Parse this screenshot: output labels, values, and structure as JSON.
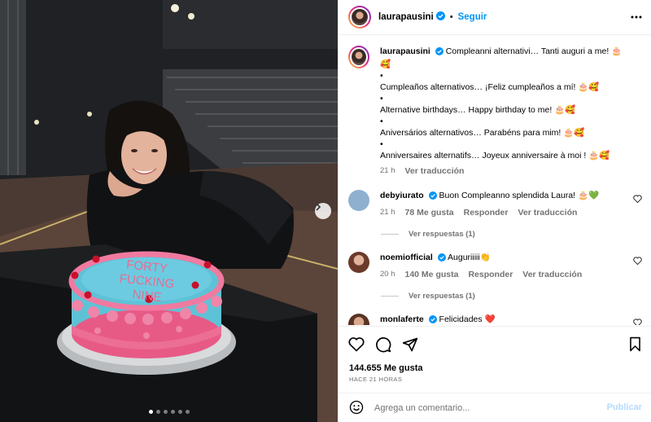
{
  "post": {
    "username": "laurapausini",
    "follow_label": "Seguir",
    "separator": "•",
    "carousel": {
      "slides": 6,
      "active": 1
    },
    "cake_text": "FORTY FUCKING NINE"
  },
  "caption": {
    "username": "laurapausini",
    "lines": [
      "Compleanni alternativi… Tanti auguri a me! 🎂🥰",
      "•",
      "Cumpleaños alternativos… ¡Feliz cumpleaños a mí! 🎂🥰",
      "•",
      "Alternative birthdays… Happy birthday to me! 🎂🥰",
      "•",
      "Aniversários alternativos… Parabéns para mim! 🎂🥰",
      "•",
      "Anniversaires alternatifs… Joyeux anniversaire à moi ! 🎂🥰"
    ],
    "time": "21 h",
    "translate": "Ver traducción"
  },
  "comments": [
    {
      "username": "debyiurato",
      "text": "Buon Compleanno splendida Laura! 🎂💚",
      "time": "21 h",
      "likes": "78 Me gusta",
      "reply": "Responder",
      "translate": "Ver traducción",
      "replies": "Ver respuestas (1)",
      "avatar_color": "#8fb0cf"
    },
    {
      "username": "noemiofficial",
      "text": "Auguriiiii👏",
      "time": "20 h",
      "likes": "140 Me gusta",
      "reply": "Responder",
      "translate": "Ver traducción",
      "replies": "Ver respuestas (1)",
      "avatar_color": "#6b3a2a"
    },
    {
      "username": "monlaferte",
      "text": "Felicidades ❤️",
      "avatar_color": "#5a3324"
    }
  ],
  "footer": {
    "likes": "144.655 Me gusta",
    "time_ago": "HACE 21 HORAS",
    "comment_placeholder": "Agrega un comentario...",
    "publish_label": "Publicar"
  },
  "colors": {
    "accent": "#0095f6",
    "verified": "#0095f6",
    "muted": "#737373",
    "publish_disabled": "#b3dbff"
  }
}
